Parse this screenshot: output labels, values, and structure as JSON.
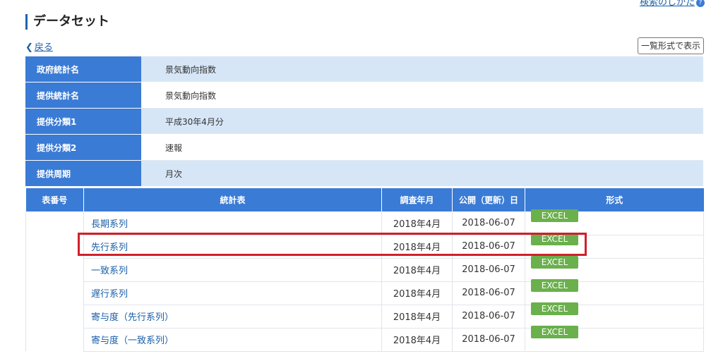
{
  "header": {
    "help_link": "検索のしかた",
    "help_icon": "?",
    "title": "データセット",
    "back_label": "戻る",
    "back_icon": "chevron-left-icon",
    "list_view_button": "一覧形式で表示"
  },
  "info": [
    {
      "label": "政府統計名",
      "value": "景気動向指数"
    },
    {
      "label": "提供統計名",
      "value": "景気動向指数"
    },
    {
      "label": "提供分類1",
      "value": "平成30年4月分"
    },
    {
      "label": "提供分類2",
      "value": "速報"
    },
    {
      "label": "提供周期",
      "value": "月次"
    }
  ],
  "table": {
    "headers": [
      "表番号",
      "統計表",
      "調査年月",
      "公開（更新）日",
      "形式"
    ],
    "rows": [
      {
        "number": "",
        "title": "長期系列",
        "survey_month": "2018年4月",
        "published": "2018-06-07",
        "format": "EXCEL"
      },
      {
        "number": "",
        "title": "先行系列",
        "survey_month": "2018年4月",
        "published": "2018-06-07",
        "format": "EXCEL"
      },
      {
        "number": "",
        "title": "一致系列",
        "survey_month": "2018年4月",
        "published": "2018-06-07",
        "format": "EXCEL"
      },
      {
        "number": "",
        "title": "遅行系列",
        "survey_month": "2018年4月",
        "published": "2018-06-07",
        "format": "EXCEL"
      },
      {
        "number": "",
        "title": "寄与度（先行系列）",
        "survey_month": "2018年4月",
        "published": "2018-06-07",
        "format": "EXCEL"
      },
      {
        "number": "",
        "title": "寄与度（一致系列）",
        "survey_month": "2018年4月",
        "published": "2018-06-07",
        "format": "EXCEL"
      }
    ]
  },
  "colors": {
    "header_blue": "#3a7bd5",
    "row_shade": "#d7e6f7",
    "excel_green": "#6ab04c",
    "highlight_red": "#d0202a",
    "link_blue": "#1a5fa8"
  }
}
